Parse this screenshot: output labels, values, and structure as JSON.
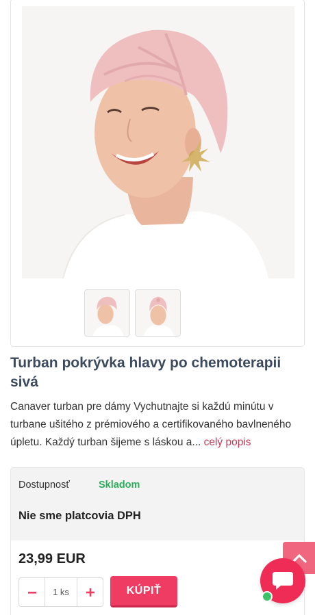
{
  "product": {
    "title": "Turban pokrývka hlavy po chemoterapii sivá",
    "description": "Canaver turban pre dámy Vychutnajte si každú minútu v turbane ušitého z prémiového a certifikovaného bavlneného úpletu. Každý turban šijeme s láskou a... ",
    "read_more": "celý popis",
    "availability_label": "Dostupnosť",
    "availability_value": "Skladom",
    "vat_note": "Nie sme platcovia DPH",
    "price": "23,99 EUR",
    "quantity": "1 ks",
    "buy_label": "KÚPIŤ"
  },
  "icons": {
    "minus": "minus-icon",
    "plus": "plus-icon",
    "scroll_top": "chevron-up-icon",
    "chat": "chat-bubble-icon"
  },
  "colors": {
    "accent": "#ef3c63",
    "title": "#3c4a5e",
    "in_stock": "#2eae5a",
    "link": "#c13a58",
    "online": "#3cc46a"
  }
}
